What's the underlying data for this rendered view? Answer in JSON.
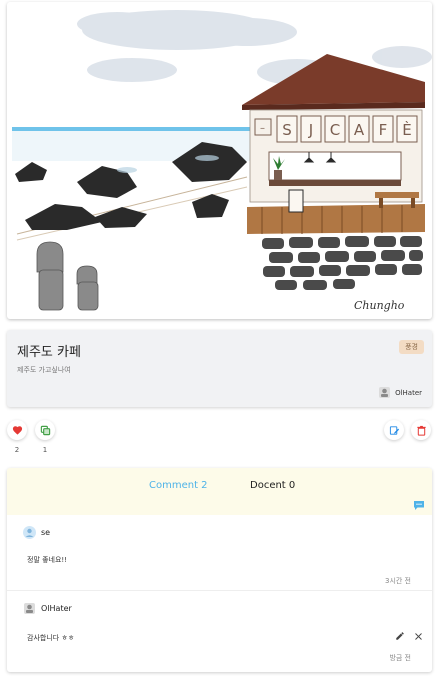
{
  "artwork": {
    "sign_letters": [
      "S",
      "J",
      "C",
      "A",
      "F",
      "È"
    ],
    "signature": "Chungho"
  },
  "post": {
    "title": "제주도 카페",
    "description": "제주도 가고싶나여",
    "category": "풍경",
    "author": "OlHater"
  },
  "actions": {
    "like_count": "2",
    "share_count": "1",
    "colors": {
      "like": "#e53935",
      "share": "#43a047",
      "edit": "#1e88e5",
      "delete": "#e53935"
    }
  },
  "tabs": {
    "comment_label": "Comment 2",
    "docent_label": "Docent 0",
    "active_color": "#4fb3e8"
  },
  "comments": [
    {
      "user": "se",
      "text": "정말 좋네요!!",
      "time": "3시간 전"
    },
    {
      "user": "OlHater",
      "text": "감사합니다 ㅎㅎ",
      "time": "방금 전"
    }
  ]
}
